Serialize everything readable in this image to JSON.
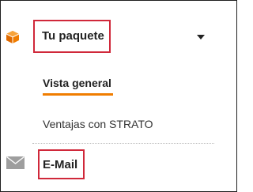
{
  "nav": {
    "package": {
      "label": "Tu paquete",
      "icon": "box-icon",
      "expand_icon": "caret-down-icon",
      "expanded": true,
      "icon_color": "#f07d00",
      "highlight_color": "#d0283a"
    },
    "sub_items": [
      {
        "label": "Vista general",
        "active": true,
        "underline_color": "#f07d00"
      },
      {
        "label": "Ventajas con STRATO",
        "active": false
      }
    ],
    "email": {
      "label": "E-Mail",
      "icon": "envelope-icon",
      "icon_color": "#9e9e9e",
      "highlight_color": "#d0283a"
    }
  }
}
